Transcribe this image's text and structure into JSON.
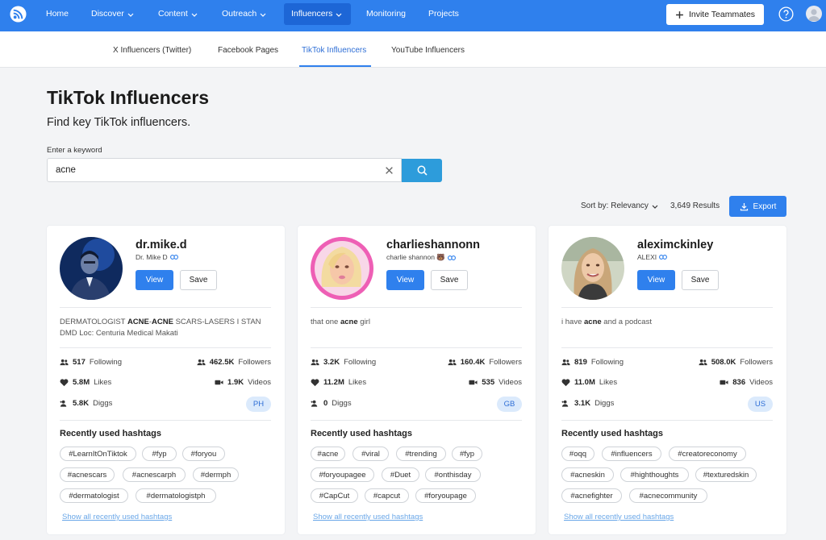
{
  "nav": {
    "items": [
      {
        "label": "Home"
      },
      {
        "label": "Discover"
      },
      {
        "label": "Content"
      },
      {
        "label": "Outreach"
      },
      {
        "label": "Influencers"
      },
      {
        "label": "Monitoring"
      },
      {
        "label": "Projects"
      }
    ],
    "active": "Influencers",
    "invite_label": "Invite Teammates",
    "accent": "#2f80ed"
  },
  "subnav": {
    "tabs": [
      {
        "label": "X Influencers (Twitter)"
      },
      {
        "label": "Facebook Pages"
      },
      {
        "label": "TikTok Influencers"
      },
      {
        "label": "YouTube Influencers"
      }
    ],
    "active": "TikTok Influencers"
  },
  "page": {
    "title": "TikTok Influencers",
    "subtitle": "Find key TikTok influencers.",
    "keyword_label": "Enter a keyword",
    "keyword_value": "acne",
    "sort_label": "Sort by: Relevancy",
    "results": "3,649 Results",
    "export_label": "Export"
  },
  "labels": {
    "view": "View",
    "save": "Save",
    "following": "Following",
    "followers": "Followers",
    "likes": "Likes",
    "videos": "Videos",
    "diggs": "Diggs",
    "hashtags_title": "Recently used hashtags",
    "show_all": "Show all recently used hashtags"
  },
  "cards": [
    {
      "username": "dr.mike.d",
      "display_name": "Dr. Mike D",
      "bio_parts": [
        {
          "t": "DERMATOLOGIST ",
          "b": false
        },
        {
          "t": "ACNE",
          "b": true
        },
        {
          "t": "-",
          "b": false
        },
        {
          "t": "ACNE",
          "b": true
        },
        {
          "t": " SCARS-LASERS I STAN DMD Loc: Centuria Medical Makati",
          "b": false
        }
      ],
      "following": "517",
      "followers": "462.5K",
      "likes": "5.8M",
      "videos": "1.9K",
      "diggs": "5.8K",
      "country": "PH",
      "hashtags": [
        "#LearnItOnTiktok",
        "#fyp",
        "#foryou",
        "#acnescars",
        "#acnescarph",
        "#dermph",
        "#dermatologist",
        "#dermatologistph"
      ]
    },
    {
      "username": "charlieshannonn",
      "display_name": "charlie shannon 🐻",
      "bio_parts": [
        {
          "t": "that one ",
          "b": false
        },
        {
          "t": "acne",
          "b": true
        },
        {
          "t": " girl",
          "b": false
        }
      ],
      "following": "3.2K",
      "followers": "160.4K",
      "likes": "11.2M",
      "videos": "535",
      "diggs": "0",
      "country": "GB",
      "hashtags": [
        "#acne",
        "#viral",
        "#trending",
        "#fyp",
        "#foryoupagee",
        "#Duet",
        "#onthisday",
        "#CapCut",
        "#capcut",
        "#foryoupage"
      ]
    },
    {
      "username": "aleximckinley",
      "display_name": "ALEXI",
      "bio_parts": [
        {
          "t": "i have ",
          "b": false
        },
        {
          "t": "acne",
          "b": true
        },
        {
          "t": " and a podcast",
          "b": false
        }
      ],
      "following": "819",
      "followers": "508.0K",
      "likes": "11.0M",
      "videos": "836",
      "diggs": "3.1K",
      "country": "US",
      "hashtags": [
        "#oqq",
        "#influencers",
        "#creatoreconomy",
        "#acneskin",
        "#highthoughts",
        "#texturedskin",
        "#acnefighter",
        "#acnecommunity"
      ]
    }
  ]
}
